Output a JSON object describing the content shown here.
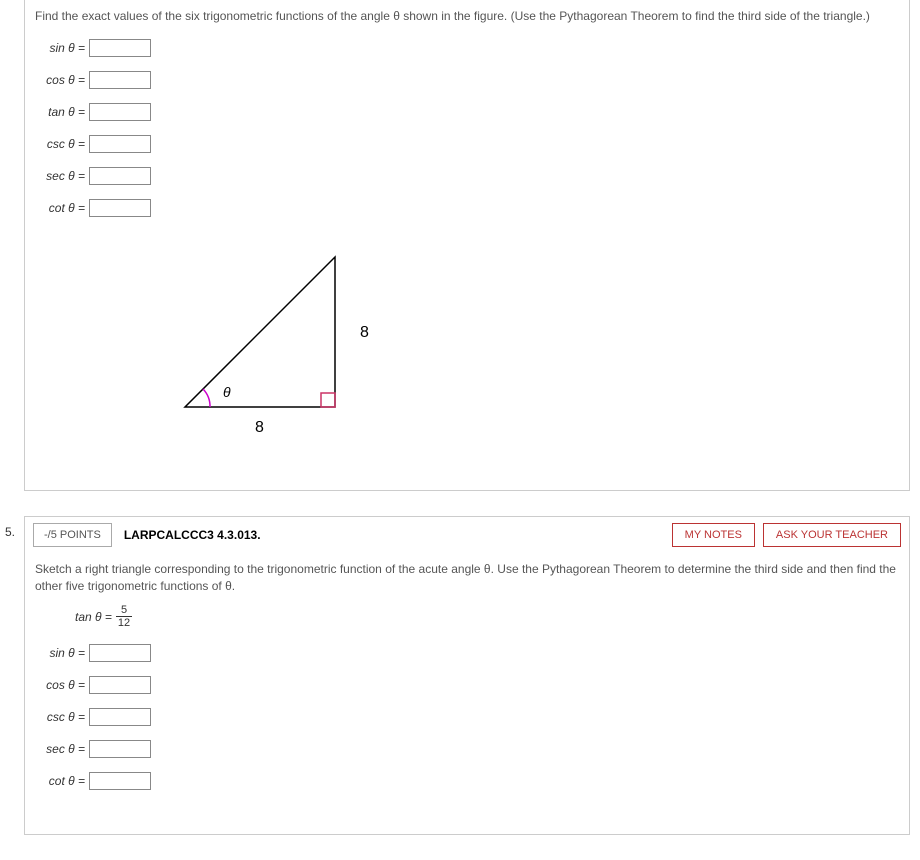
{
  "q1": {
    "instruction": "Find the exact values of the six trigonometric functions of the angle θ shown in the figure. (Use the Pythagorean Theorem to find the third side of the triangle.)",
    "funcs": {
      "sin": "sin θ =",
      "cos": "cos θ =",
      "tan": "tan θ =",
      "csc": "csc θ =",
      "sec": "sec θ =",
      "cot": "cot θ ="
    },
    "triangle": {
      "side_bottom": "8",
      "side_right": "8",
      "angle_label": "θ"
    }
  },
  "q2": {
    "number": "5.",
    "points": "-/5 POINTS",
    "ref": "LARPCALCCC3 4.3.013.",
    "btn_notes": "MY NOTES",
    "btn_ask": "ASK YOUR TEACHER",
    "instruction": "Sketch a right triangle corresponding to the trigonometric function of the acute angle θ. Use the Pythagorean Theorem to determine the third side and then find the other five trigonometric functions of θ.",
    "given_label": "tan θ =",
    "given_num": "5",
    "given_den": "12",
    "funcs": {
      "sin": "sin θ =",
      "cos": "cos θ =",
      "csc": "csc θ =",
      "sec": "sec θ =",
      "cot": "cot θ ="
    }
  }
}
